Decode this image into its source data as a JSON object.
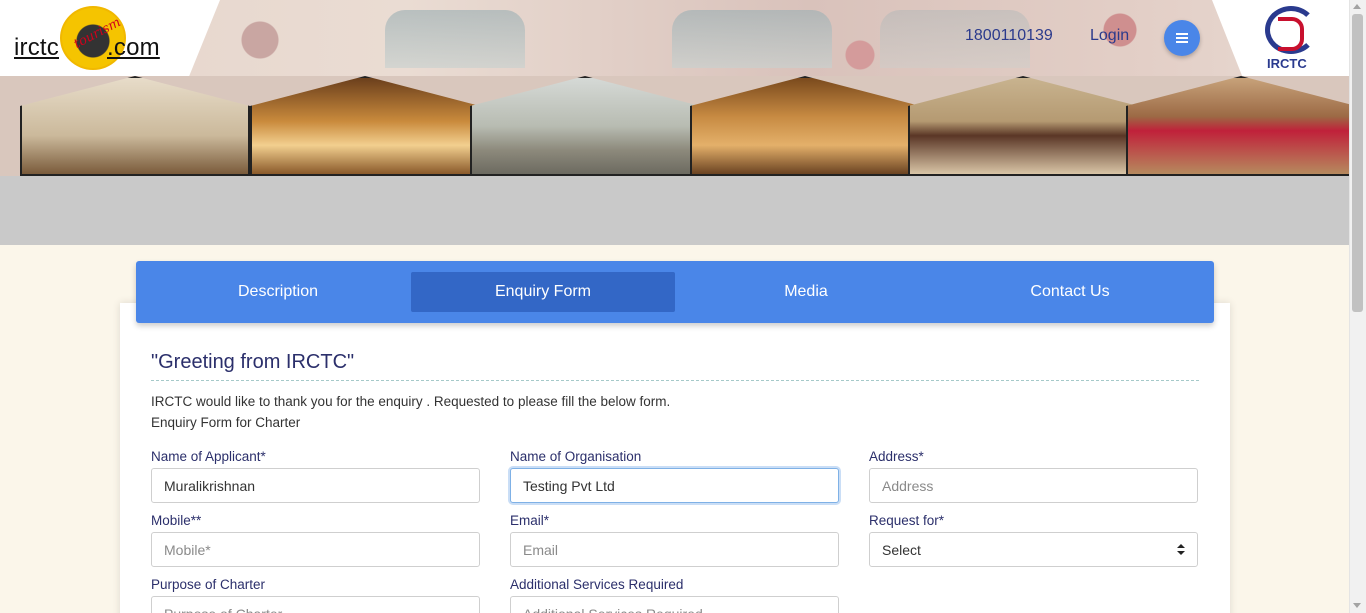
{
  "header": {
    "logo_left": "irctc",
    "logo_right": ".com",
    "logo_tag": "tourism",
    "phone": "1800110139",
    "login_label": "Login",
    "menu_icon": "hamburger-icon",
    "brand_mark_label": "IRCTC"
  },
  "tabs": [
    {
      "label": "Description",
      "active": false
    },
    {
      "label": "Enquiry Form",
      "active": true
    },
    {
      "label": "Media",
      "active": false
    },
    {
      "label": "Contact Us",
      "active": false
    }
  ],
  "form": {
    "greeting": "\"Greeting from IRCTC\"",
    "intro_line1": "IRCTC would like to thank you for the enquiry . Requested to please fill the below form.",
    "intro_line2": "Enquiry Form for Charter",
    "fields": {
      "applicant": {
        "label": "Name of Applicant*",
        "value": "Muralikrishnan",
        "placeholder": ""
      },
      "organisation": {
        "label": "Name of Organisation",
        "value": "Testing Pvt Ltd",
        "placeholder": ""
      },
      "address": {
        "label": "Address*",
        "value": "",
        "placeholder": "Address"
      },
      "mobile": {
        "label": "Mobile**",
        "value": "",
        "placeholder": "Mobile*"
      },
      "email": {
        "label": "Email*",
        "value": "",
        "placeholder": "Email"
      },
      "request_for": {
        "label": "Request for*",
        "selected": "Select"
      },
      "purpose": {
        "label": "Purpose of Charter",
        "value": "",
        "placeholder": "Purpose of Charter"
      },
      "services": {
        "label": "Additional Services Required",
        "value": "",
        "placeholder": "Additional Services Required"
      }
    }
  },
  "colors": {
    "tab_bar": "#4a86e8",
    "tab_active": "#3367c6",
    "label_text": "#2b2f6b",
    "page_bg": "#fbf6ea"
  }
}
